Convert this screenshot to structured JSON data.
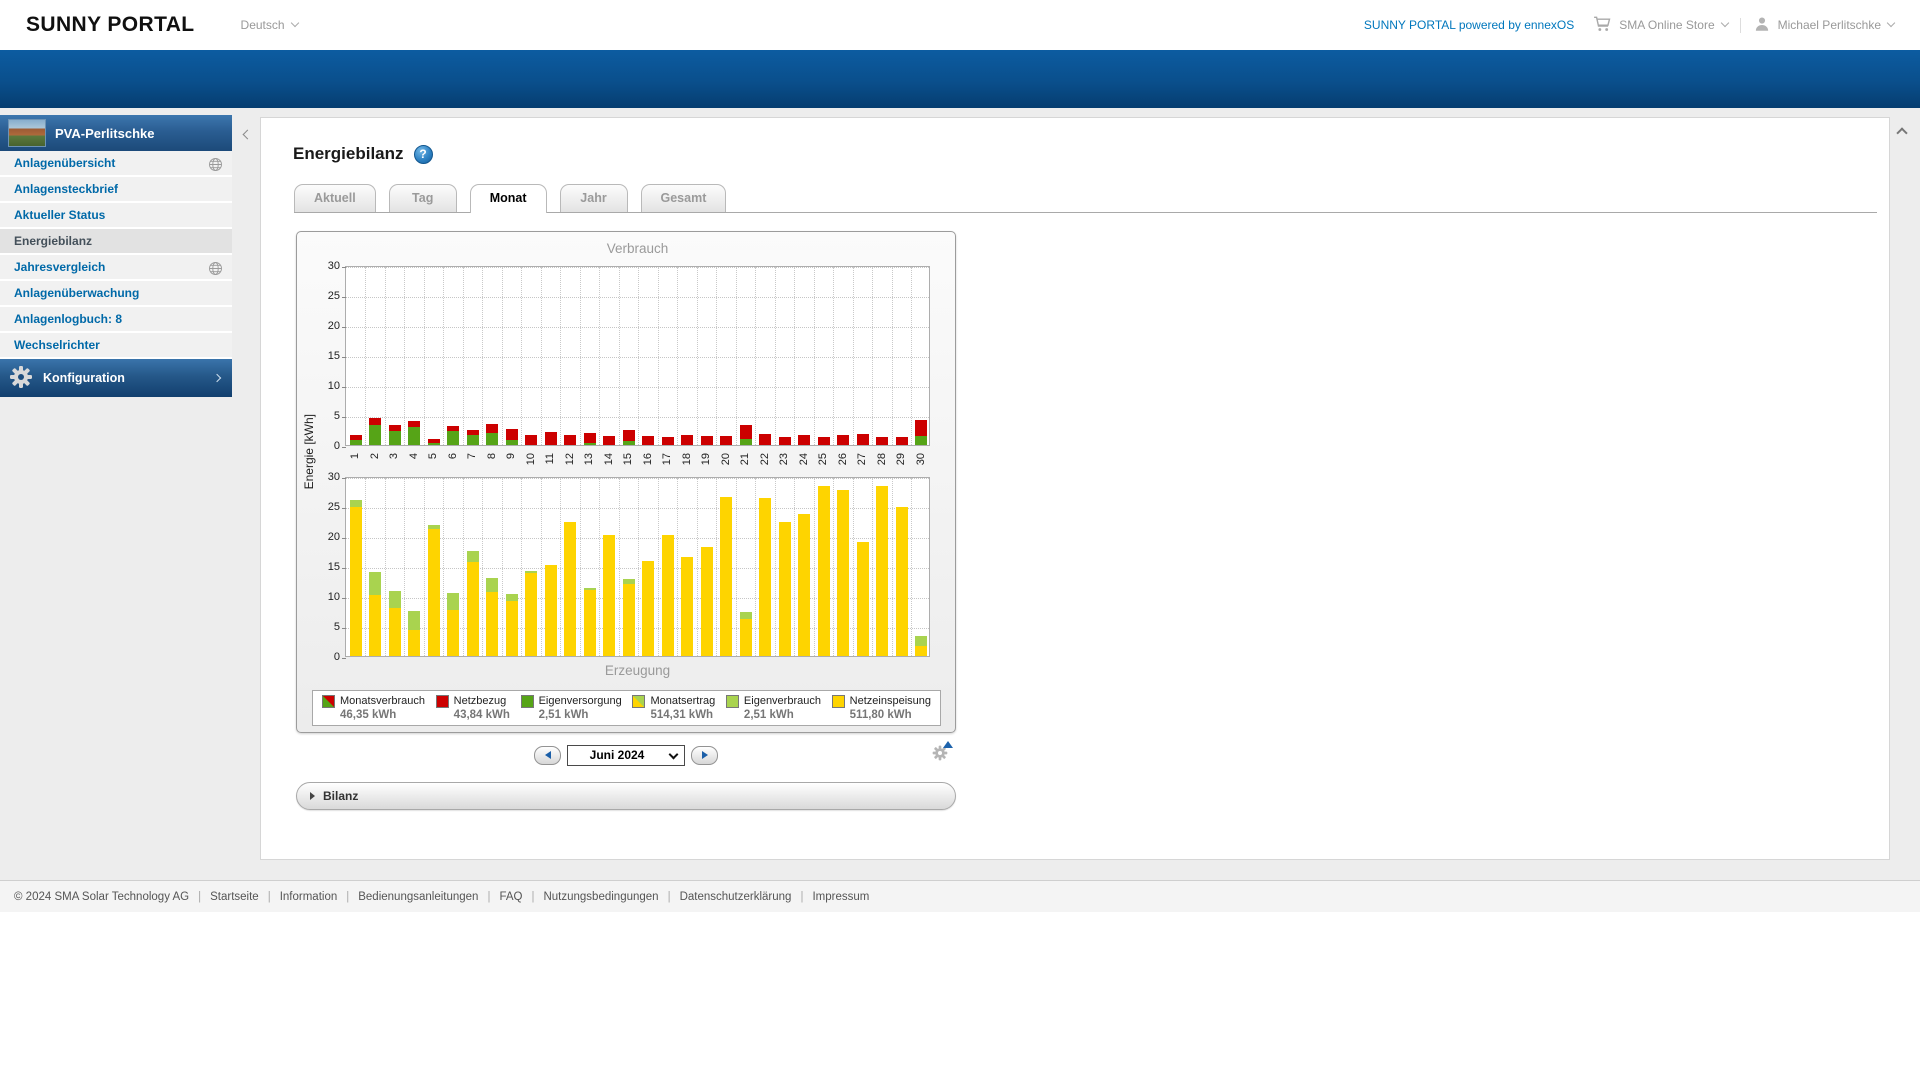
{
  "header": {
    "brand": "SUNNY PORTAL",
    "language": "Deutsch",
    "powered_by": "SUNNY PORTAL powered by ennexOS",
    "store": "SMA Online Store",
    "user": "Michael Perlitschke"
  },
  "sidebar": {
    "site_name": "PVA-Perlitschke",
    "items": [
      {
        "key": "anlagenuebersicht",
        "label": "Anlagenübersicht",
        "globe": true,
        "active": false
      },
      {
        "key": "anlagensteckbrief",
        "label": "Anlagensteckbrief",
        "globe": false,
        "active": false
      },
      {
        "key": "aktueller-status",
        "label": "Aktueller Status",
        "globe": false,
        "active": false
      },
      {
        "key": "energiebilanz",
        "label": "Energiebilanz",
        "globe": false,
        "active": true
      },
      {
        "key": "jahresvergleich",
        "label": "Jahresvergleich",
        "globe": true,
        "active": false
      },
      {
        "key": "anlagenueberwachung",
        "label": "Anlagenüberwachung",
        "globe": false,
        "active": false
      },
      {
        "key": "anlagenlogbuch",
        "label": "Anlagenlogbuch: 8",
        "globe": false,
        "active": false
      },
      {
        "key": "wechselrichter",
        "label": "Wechselrichter",
        "globe": false,
        "active": false
      }
    ],
    "config_label": "Konfiguration"
  },
  "content": {
    "title": "Energiebilanz",
    "help_glyph": "?",
    "tabs": [
      {
        "key": "aktuell",
        "label": "Aktuell",
        "active": false
      },
      {
        "key": "tag",
        "label": "Tag",
        "active": false
      },
      {
        "key": "monat",
        "label": "Monat",
        "active": true
      },
      {
        "key": "jahr",
        "label": "Jahr",
        "active": false
      },
      {
        "key": "gesamt",
        "label": "Gesamt",
        "active": false
      }
    ],
    "period_selected": "Juni 2024",
    "bilanz_label": "Bilanz"
  },
  "chart_data": [
    {
      "type": "bar",
      "stacked": true,
      "title": "Verbrauch",
      "title_position": "top",
      "xlabel": "",
      "ylabel": "Energie [kWh]",
      "ylim": [
        0,
        30
      ],
      "yticks": [
        0,
        5,
        10,
        15,
        20,
        25,
        30
      ],
      "grid": true,
      "unit": "kWh",
      "categories": [
        1,
        2,
        3,
        4,
        5,
        6,
        7,
        8,
        9,
        10,
        11,
        12,
        13,
        14,
        15,
        16,
        17,
        18,
        19,
        20,
        21,
        22,
        23,
        24,
        25,
        26,
        27,
        28,
        29,
        30
      ],
      "series": [
        {
          "name": "Eigenversorgung",
          "color": "#56a417",
          "values": [
            0.9,
            3.3,
            2.4,
            3.0,
            0.4,
            2.4,
            1.6,
            2.0,
            0.9,
            0,
            0,
            0,
            0.3,
            0,
            0.6,
            0,
            0,
            0,
            0,
            0,
            1.0,
            0,
            0,
            0,
            0,
            0,
            0,
            0,
            0,
            1.5
          ]
        },
        {
          "name": "Netzbezug",
          "color": "#cc0000",
          "values": [
            0.9,
            1.1,
            1.0,
            1.0,
            0.6,
            0.9,
            0.9,
            1.5,
            1.9,
            1.7,
            2.1,
            1.6,
            1.6,
            1.5,
            1.9,
            1.5,
            1.4,
            1.7,
            1.5,
            1.5,
            2.3,
            1.9,
            1.4,
            1.7,
            1.4,
            1.6,
            1.9,
            1.4,
            1.4,
            2.7
          ]
        }
      ]
    },
    {
      "type": "bar",
      "stacked": true,
      "title": "Erzeugung",
      "title_position": "bottom",
      "xlabel": "",
      "ylabel": "Energie [kWh]",
      "ylim": [
        0,
        30
      ],
      "yticks": [
        0,
        5,
        10,
        15,
        20,
        25,
        30
      ],
      "grid": true,
      "unit": "kWh",
      "categories": [
        1,
        2,
        3,
        4,
        5,
        6,
        7,
        8,
        9,
        10,
        11,
        12,
        13,
        14,
        15,
        16,
        17,
        18,
        19,
        20,
        21,
        22,
        23,
        24,
        25,
        26,
        27,
        28,
        29,
        30
      ],
      "series": [
        {
          "name": "Netzeinspeisung",
          "color": "#fed400",
          "values": [
            24.8,
            10.2,
            8.0,
            4.4,
            21.2,
            7.6,
            15.6,
            10.7,
            9.2,
            13.8,
            15.2,
            22.3,
            11.0,
            20.1,
            12.0,
            15.8,
            20.2,
            16.5,
            18.2,
            26.5,
            6.2,
            26.3,
            22.3,
            23.7,
            28.4,
            27.7,
            19.0,
            28.4,
            24.8,
            1.6
          ]
        },
        {
          "name": "Eigenverbrauch",
          "color": "#a9d34f",
          "values": [
            1.2,
            3.8,
            2.8,
            3.2,
            0.6,
            2.9,
            1.9,
            2.3,
            1.2,
            0.3,
            0,
            0,
            0.4,
            0,
            0.9,
            0,
            0,
            0,
            0,
            0,
            1.1,
            0,
            0,
            0,
            0,
            0,
            0,
            0,
            0,
            1.7
          ]
        }
      ]
    }
  ],
  "legend": [
    {
      "label": "Monatsverbrauch",
      "value": "46,35 kWh",
      "colors": [
        "#56a417",
        "#cc0000"
      ]
    },
    {
      "label": "Netzbezug",
      "value": "43,84 kWh",
      "colors": [
        "#cc0000"
      ]
    },
    {
      "label": "Eigenversorgung",
      "value": "2,51 kWh",
      "colors": [
        "#56a417"
      ]
    },
    {
      "label": "Monatsertrag",
      "value": "514,31 kWh",
      "colors": [
        "#fed400",
        "#a9d34f"
      ]
    },
    {
      "label": "Eigenverbrauch",
      "value": "2,51 kWh",
      "colors": [
        "#a9d34f"
      ]
    },
    {
      "label": "Netzeinspeisung",
      "value": "511,80 kWh",
      "colors": [
        "#fed400"
      ]
    }
  ],
  "footer": {
    "copyright": "© 2024 SMA Solar Technology AG",
    "separator": "|",
    "links": [
      "Startseite",
      "Information",
      "Bedienungsanleitungen",
      "FAQ",
      "Nutzungsbedingungen",
      "Datenschutzerklärung",
      "Impressum"
    ]
  }
}
